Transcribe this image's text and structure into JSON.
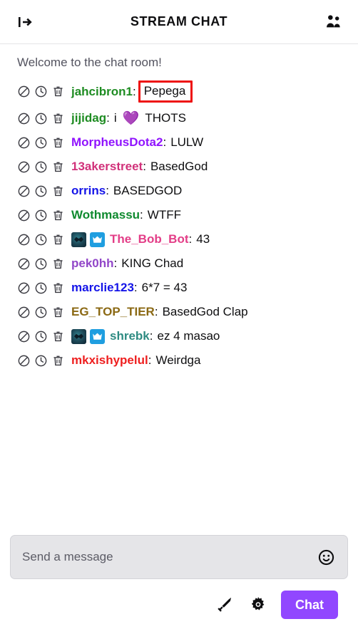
{
  "header": {
    "title": "STREAM CHAT",
    "collapse_icon": "collapse-right-arrow-icon",
    "community_icon": "community-users-icon"
  },
  "colors": {
    "accent_purple": "#9147ff",
    "highlight_box": "#ee1111",
    "badge_vip": "#1f9ee0",
    "input_bg": "#e5e5e8"
  },
  "chat": {
    "welcome": "Welcome to the chat room!",
    "mod_actions": [
      "ban-icon",
      "timeout-icon",
      "delete-icon"
    ],
    "messages": [
      {
        "username": "jahcibron1",
        "color": "#1e8c22",
        "badges": [],
        "text": "Pepega",
        "highlighted": true,
        "emote": ""
      },
      {
        "username": "jijidag",
        "color": "#1e8c22",
        "badges": [],
        "text": "i",
        "text_after": "THOTS",
        "highlighted": false,
        "emote": "💜"
      },
      {
        "username": "MorpheusDota2",
        "color": "#9013fe",
        "badges": [],
        "text": "LULW",
        "highlighted": false,
        "emote": ""
      },
      {
        "username": "13akerstreet",
        "color": "#d1317a",
        "badges": [],
        "text": "BasedGod",
        "highlighted": false,
        "emote": ""
      },
      {
        "username": "orrins",
        "color": "#1414e8",
        "badges": [],
        "text": "BASEDGOD",
        "highlighted": false,
        "emote": ""
      },
      {
        "username": "Wothmassu",
        "color": "#0f8a2f",
        "badges": [],
        "text": "WTFF",
        "highlighted": false,
        "emote": ""
      },
      {
        "username": "The_Bob_Bot",
        "color": "#e33d87",
        "badges": [
          "subscriber-badge",
          "vip-crown-badge"
        ],
        "text": "43",
        "highlighted": false,
        "emote": ""
      },
      {
        "username": "pek0hh",
        "color": "#9146c8",
        "badges": [],
        "text": "KING Chad",
        "highlighted": false,
        "emote": ""
      },
      {
        "username": "marclie123",
        "color": "#1414e8",
        "badges": [],
        "text": "6*7 = 43",
        "highlighted": false,
        "emote": ""
      },
      {
        "username": "EG_TOP_TIER",
        "color": "#8b6914",
        "badges": [],
        "text": "BasedGod Clap",
        "highlighted": false,
        "emote": ""
      },
      {
        "username": "shrebk",
        "color": "#2e8b82",
        "badges": [
          "subscriber-badge",
          "vip-crown-badge"
        ],
        "text": "ez 4 masao",
        "highlighted": false,
        "emote": ""
      },
      {
        "username": "mkxishypelul",
        "color": "#ee1f1f",
        "badges": [],
        "text": "Weirdga",
        "highlighted": false,
        "emote": ""
      }
    ]
  },
  "composer": {
    "placeholder": "Send a message",
    "value": "",
    "emote_icon": "emote-smiley-icon",
    "mod_tools_icon": "sword-icon",
    "settings_icon": "gear-icon",
    "send_label": "Chat"
  }
}
